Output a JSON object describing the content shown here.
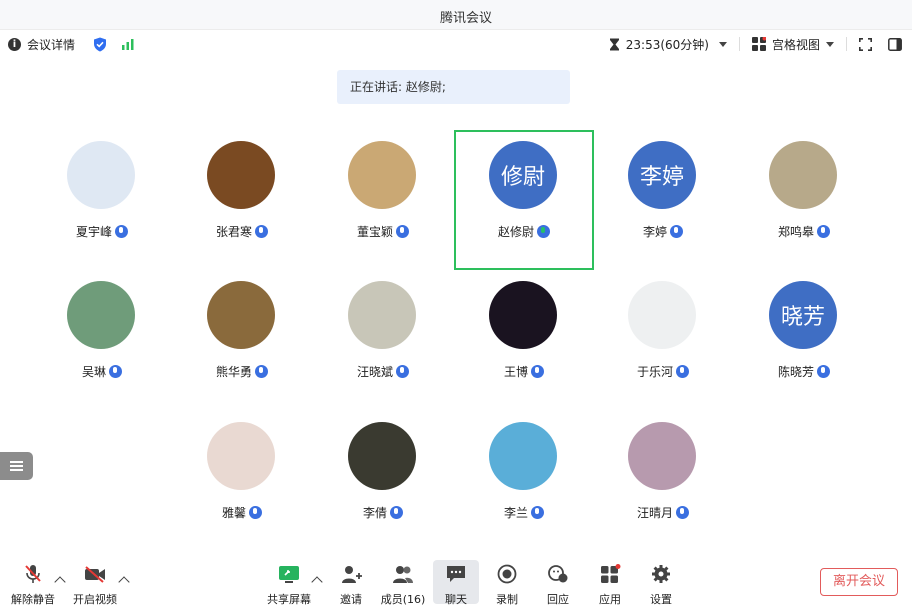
{
  "window": {
    "title": "腾讯会议"
  },
  "infobar": {
    "details_label": "会议详情",
    "timer": "23:53(60分钟)",
    "view_label": "宫格视图"
  },
  "speaking_banner": "正在讲话: 赵修尉;",
  "participants": [
    {
      "name": "夏宇峰",
      "avatar_text": "",
      "avatar_color": "#dfe8f3"
    },
    {
      "name": "张君寒",
      "avatar_text": "",
      "avatar_color": "#7a4a22"
    },
    {
      "name": "董宝颖",
      "avatar_text": "",
      "avatar_color": "#caa874"
    },
    {
      "name": "赵修尉",
      "avatar_text": "修尉",
      "avatar_color": "#3f6ec4"
    },
    {
      "name": "李婷",
      "avatar_text": "李婷",
      "avatar_color": "#3f6ec4"
    },
    {
      "name": "郑鸣皋",
      "avatar_text": "",
      "avatar_color": "#b7a98a"
    },
    {
      "name": "吴琳",
      "avatar_text": "",
      "avatar_color": "#6f9c7a"
    },
    {
      "name": "熊华勇",
      "avatar_text": "",
      "avatar_color": "#8a6a3c"
    },
    {
      "name": "汪晓斌",
      "avatar_text": "",
      "avatar_color": "#c8c6b8"
    },
    {
      "name": "王博",
      "avatar_text": "",
      "avatar_color": "#1a1320"
    },
    {
      "name": "于乐河",
      "avatar_text": "",
      "avatar_color": "#eef0f1"
    },
    {
      "name": "陈晓芳",
      "avatar_text": "晓芳",
      "avatar_color": "#3f6ec4"
    },
    {
      "name": "雅馨",
      "avatar_text": "",
      "avatar_color": "#e9d9d2"
    },
    {
      "name": "李倩",
      "avatar_text": "",
      "avatar_color": "#3a3a30"
    },
    {
      "name": "李兰",
      "avatar_text": "",
      "avatar_color": "#5aaed8"
    },
    {
      "name": "汪晴月",
      "avatar_text": "",
      "avatar_color": "#b79aae"
    }
  ],
  "toolbar": {
    "unmute": "解除静音",
    "start_video": "开启视频",
    "share_screen": "共享屏幕",
    "invite": "邀请",
    "members": "成员(16)",
    "chat": "聊天",
    "record": "录制",
    "reactions": "回应",
    "apps": "应用",
    "settings": "设置",
    "leave": "离开会议"
  },
  "colors": {
    "accent_blue": "#3f6ec4",
    "speaking_border": "#2dbf5c",
    "leave_red": "#e25b5b",
    "recording_red": "#e53935"
  }
}
